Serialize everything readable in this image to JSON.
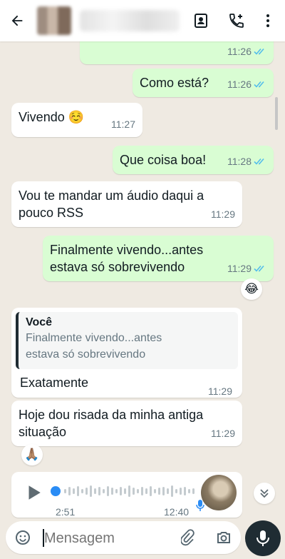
{
  "header": {
    "back_icon": "arrow-left-icon",
    "contact_icon": "contact-card-icon",
    "call_icon": "add-call-icon",
    "menu_icon": "more-vert-icon"
  },
  "messages": [
    {
      "direction": "out",
      "text": "",
      "time": "11:26",
      "read": true
    },
    {
      "direction": "out",
      "text": "Como está?",
      "time": "11:26",
      "read": true
    },
    {
      "direction": "in",
      "text": "Vivendo ☺️",
      "time": "11:27"
    },
    {
      "direction": "out",
      "text": "Que coisa boa!",
      "time": "11:28",
      "read": true
    },
    {
      "direction": "in",
      "line1": "Vou te mandar um áudio daqui a",
      "line2": "pouco RSS",
      "time": "11:29"
    },
    {
      "direction": "out",
      "line1": "Finalmente vivendo...antes",
      "line2": "estava só sobrevivendo",
      "time": "11:29",
      "read": true,
      "reaction": "😂"
    },
    {
      "direction": "in",
      "quote_author": "Você",
      "quote_line1": "Finalmente vivendo...antes",
      "quote_line2": "estava só sobrevivendo",
      "text": "Exatamente",
      "time": "11:29"
    },
    {
      "direction": "in",
      "line1": "Hoje dou risada da minha antiga",
      "line2": "situação",
      "time": "11:29",
      "reaction": "🙏🏽"
    }
  ],
  "voice_message": {
    "duration": "2:51",
    "time": "12:40",
    "progress": 0.0
  },
  "composer": {
    "placeholder": "Mensagem",
    "emoji_icon": "emoji-icon",
    "attach_icon": "paperclip-icon",
    "camera_icon": "camera-icon",
    "mic_icon": "microphone-icon"
  },
  "colors": {
    "outgoing_bubble": "#d9fdd3",
    "incoming_bubble": "#ffffff",
    "read_ticks": "#53bdeb",
    "chat_background": "#efeae2",
    "mic_button": "#1f2c33"
  }
}
